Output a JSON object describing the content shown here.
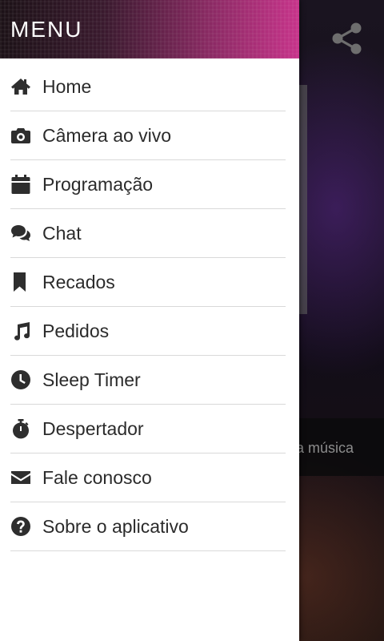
{
  "background": {
    "bar_text": "a música",
    "share_icon": "share-icon"
  },
  "drawer": {
    "title": "MENU",
    "items": [
      {
        "label": "Home",
        "icon": "home-icon"
      },
      {
        "label": "Câmera ao vivo",
        "icon": "camera-icon"
      },
      {
        "label": "Programação",
        "icon": "calendar-icon"
      },
      {
        "label": "Chat",
        "icon": "chat-icon"
      },
      {
        "label": "Recados",
        "icon": "bookmark-icon"
      },
      {
        "label": "Pedidos",
        "icon": "music-note-icon"
      },
      {
        "label": "Sleep Timer",
        "icon": "clock-icon"
      },
      {
        "label": "Despertador",
        "icon": "stopwatch-icon"
      },
      {
        "label": "Fale conosco",
        "icon": "envelope-icon"
      },
      {
        "label": "Sobre o aplicativo",
        "icon": "question-circle-icon"
      }
    ]
  }
}
